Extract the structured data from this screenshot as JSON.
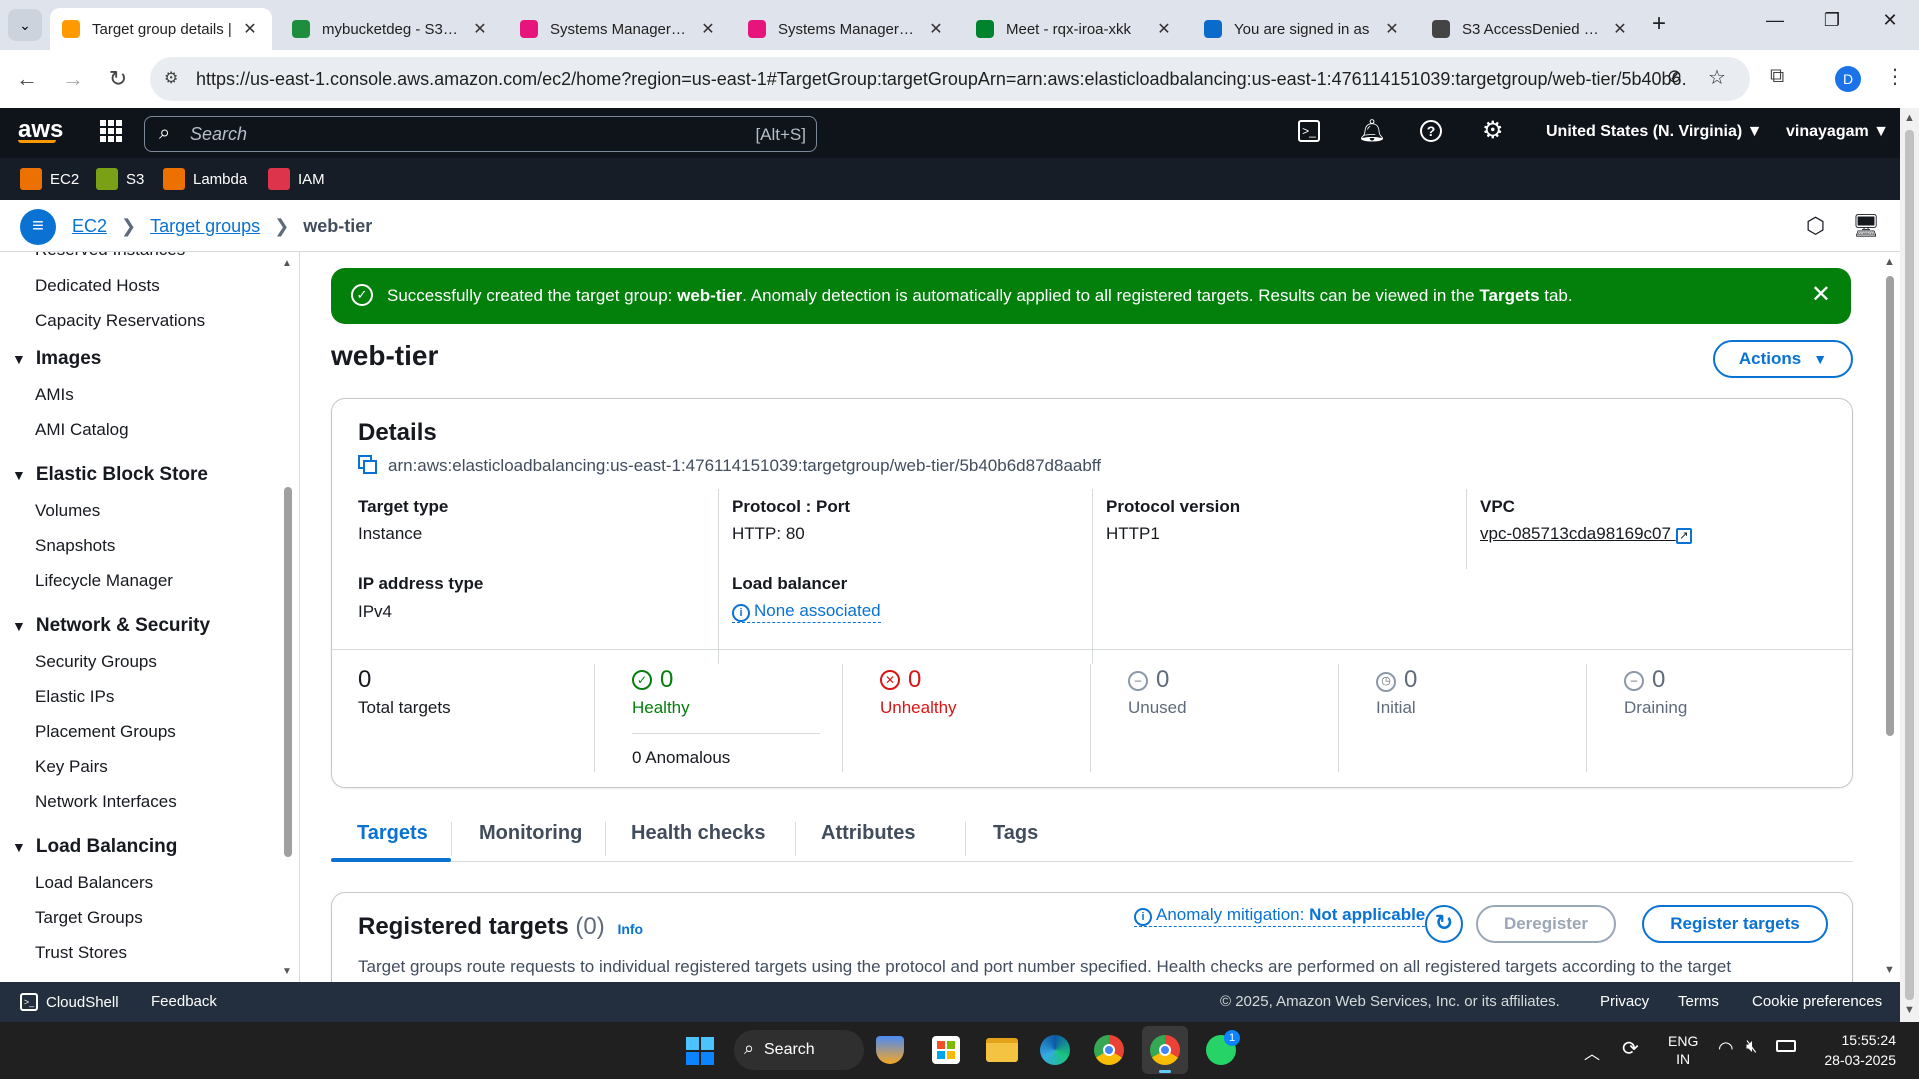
{
  "browser": {
    "tabs": [
      {
        "title": "Target group details |",
        "color": "#ff9900",
        "active": true
      },
      {
        "title": "mybucketdeg - S3 bu",
        "color": "#1e8e3e"
      },
      {
        "title": "Systems Manager | u",
        "color": "#e7157b"
      },
      {
        "title": "Systems Manager | u",
        "color": "#e7157b"
      },
      {
        "title": "Meet - rqx-iroa-xkk",
        "color": "#00832d"
      },
      {
        "title": "You are signed in as",
        "color": "#0b6bcb"
      },
      {
        "title": "S3 AccessDenied Res",
        "color": "#444444"
      }
    ],
    "new_tab": "+",
    "url": "https://us-east-1.console.aws.amazon.com/ec2/home?region=us-east-1#TargetGroup:targetGroupArn=arn:aws:elasticloadbalancing:us-east-1:476114151039:targetgroup/web-tier/5b40b6...",
    "profile_initial": "D"
  },
  "aws_header": {
    "search_placeholder": "Search",
    "search_shortcut": "[Alt+S]",
    "region": "United States (N. Virginia) ▼",
    "user": "vinayagam ▼"
  },
  "favorites": [
    {
      "label": "EC2",
      "color": "#ed7100"
    },
    {
      "label": "S3",
      "color": "#7aa116"
    },
    {
      "label": "Lambda",
      "color": "#ed7100"
    },
    {
      "label": "IAM",
      "color": "#dd344c"
    }
  ],
  "breadcrumb": {
    "items": [
      "EC2",
      "Target groups"
    ],
    "current": "web-tier",
    "sep": ">"
  },
  "sidebar": {
    "partial_top": "Reserved Instances",
    "items_instances": [
      "Dedicated Hosts",
      "Capacity Reservations"
    ],
    "sections": [
      {
        "title": "Images",
        "items": [
          "AMIs",
          "AMI Catalog"
        ]
      },
      {
        "title": "Elastic Block Store",
        "items": [
          "Volumes",
          "Snapshots",
          "Lifecycle Manager"
        ]
      },
      {
        "title": "Network & Security",
        "items": [
          "Security Groups",
          "Elastic IPs",
          "Placement Groups",
          "Key Pairs",
          "Network Interfaces"
        ]
      },
      {
        "title": "Load Balancing",
        "items": [
          "Load Balancers",
          "Target Groups",
          "Trust Stores"
        ]
      }
    ]
  },
  "flash": {
    "prefix": "Successfully created the target group: ",
    "name": "web-tier",
    "middle": ". Anomaly detection is automatically applied to all registered targets. Results can be viewed in the ",
    "tab": "Targets",
    "suffix": " tab."
  },
  "page": {
    "title": "web-tier",
    "actions": "Actions"
  },
  "details": {
    "heading": "Details",
    "arn": "arn:aws:elasticloadbalancing:us-east-1:476114151039:targetgroup/web-tier/5b40b6d87d8aabff",
    "target_type_label": "Target type",
    "target_type": "Instance",
    "protocol_port_label": "Protocol : Port",
    "protocol_port": "HTTP: 80",
    "protocol_version_label": "Protocol version",
    "protocol_version": "HTTP1",
    "vpc_label": "VPC",
    "vpc": "vpc-085713cda98169c07",
    "ip_type_label": "IP address type",
    "ip_type": "IPv4",
    "lb_label": "Load balancer",
    "lb": "None associated"
  },
  "stats": {
    "total": {
      "value": "0",
      "label": "Total targets"
    },
    "healthy": {
      "value": "0",
      "label": "Healthy",
      "color": "#037f0c"
    },
    "anomalous": "0 Anomalous",
    "unhealthy": {
      "value": "0",
      "label": "Unhealthy",
      "color": "#d91515"
    },
    "unused": {
      "value": "0",
      "label": "Unused"
    },
    "initial": {
      "value": "0",
      "label": "Initial"
    },
    "draining": {
      "value": "0",
      "label": "Draining"
    }
  },
  "tabs": [
    "Targets",
    "Monitoring",
    "Health checks",
    "Attributes",
    "Tags"
  ],
  "registered": {
    "title": "Registered targets",
    "count": "(0)",
    "info": "Info",
    "anomaly_label": "Anomaly mitigation: ",
    "anomaly_value": "Not applicable",
    "deregister": "Deregister",
    "register": "Register targets",
    "description": "Target groups route requests to individual registered targets using the protocol and port number specified. Health checks are performed on all registered targets according to the target"
  },
  "footer": {
    "cloudshell": "CloudShell",
    "feedback": "Feedback",
    "copyright": "© 2025, Amazon Web Services, Inc. or its affiliates.",
    "privacy": "Privacy",
    "terms": "Terms",
    "cookies": "Cookie preferences"
  },
  "taskbar": {
    "search": "Search",
    "lang1": "ENG",
    "lang2": "IN",
    "time": "15:55:24",
    "date": "28-03-2025",
    "badge_whatsapp": "1"
  }
}
